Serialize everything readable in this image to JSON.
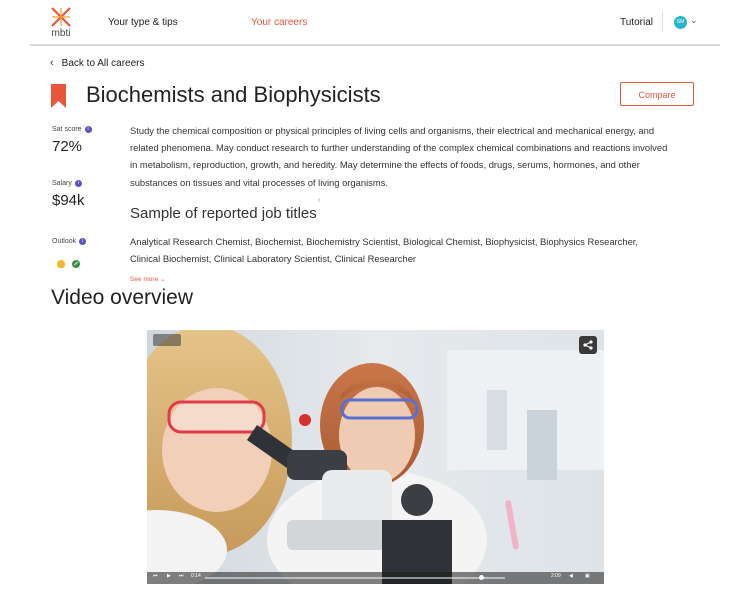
{
  "nav": {
    "logo_text": "mbti",
    "links": [
      "Your type & tips",
      "Your careers"
    ],
    "tutorial": "Tutorial",
    "avatar_initials": "SM",
    "accent_color": "#e8573c"
  },
  "back_label": "Back to All careers",
  "career": {
    "title": "Biochemists and Biophysicists",
    "compare_label": "Compare",
    "stats": {
      "sat_score_label": "Sat score",
      "sat_score_value": "72%",
      "salary_label": "Salary",
      "salary_value": "$94k",
      "outlook_label": "Outlook"
    },
    "description": "Study the chemical composition or physical principles of living cells and organisms, their electrical and mechanical energy, and related phenomena. May conduct research to further understanding of the complex chemical combinations and reactions involved in metabolism, reproduction, growth, and heredity. May determine the effects of foods, drugs, serums, hormones, and other substances on tissues and vital processes of living organisms.",
    "job_titles_heading": "Sample of reported job titles",
    "job_titles": "Analytical Research Chemist, Biochemist, Biochemistry Scientist, Biological Chemist, Biophysicist, Biophysics Researcher, Clinical Biochemist, Clinical Laboratory Scientist, Clinical Researcher",
    "see_more": "See more"
  },
  "video": {
    "heading": "Video overview",
    "progress_fraction": 0.92,
    "time_elapsed": "0:14",
    "time_total": "2:09"
  }
}
